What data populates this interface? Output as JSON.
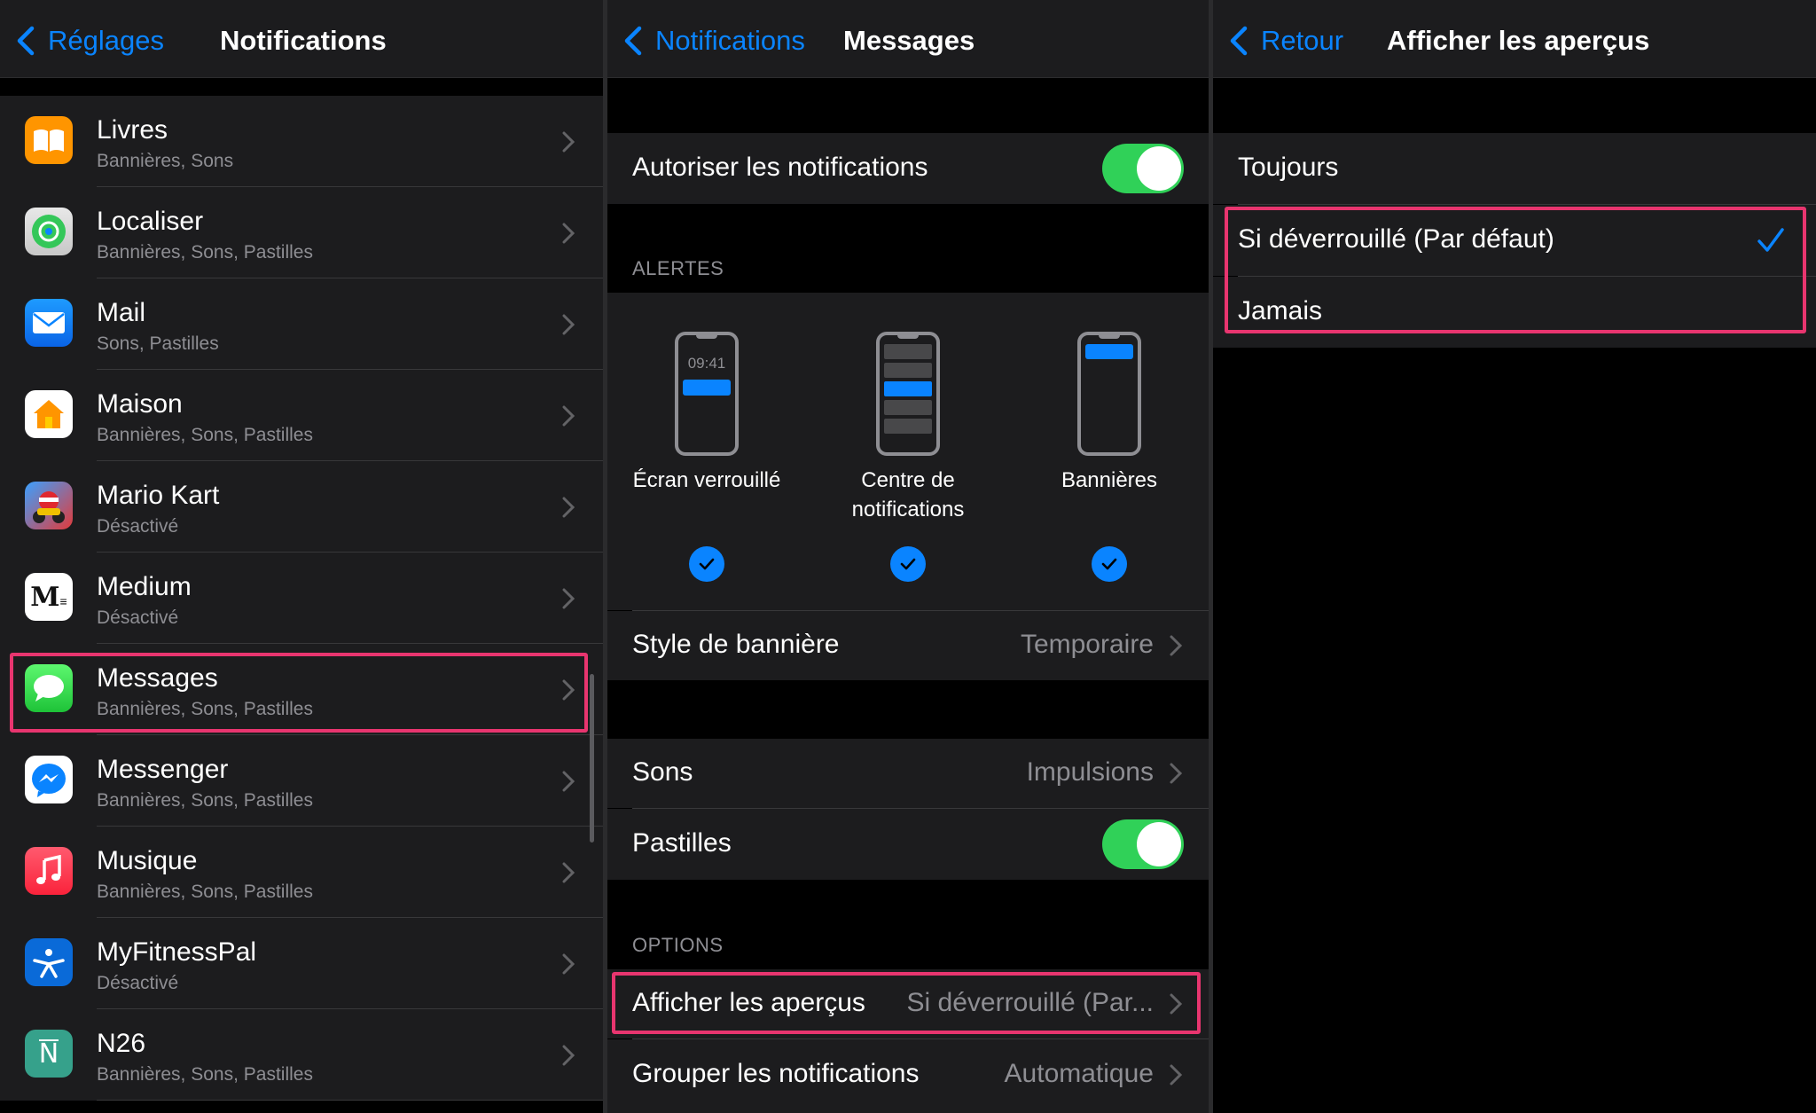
{
  "panel1": {
    "back_label": "Réglages",
    "title": "Notifications",
    "apps": [
      {
        "name": "Livres",
        "sub": "Bannières, Sons",
        "icon": "books-icon"
      },
      {
        "name": "Localiser",
        "sub": "Bannières, Sons, Pastilles",
        "icon": "find-my-icon"
      },
      {
        "name": "Mail",
        "sub": "Sons, Pastilles",
        "icon": "mail-icon"
      },
      {
        "name": "Maison",
        "sub": "Bannières, Sons, Pastilles",
        "icon": "home-icon"
      },
      {
        "name": "Mario Kart",
        "sub": "Désactivé",
        "icon": "mario-kart-icon"
      },
      {
        "name": "Medium",
        "sub": "Désactivé",
        "icon": "medium-icon"
      },
      {
        "name": "Messages",
        "sub": "Bannières, Sons, Pastilles",
        "icon": "messages-icon"
      },
      {
        "name": "Messenger",
        "sub": "Bannières, Sons, Pastilles",
        "icon": "messenger-icon"
      },
      {
        "name": "Musique",
        "sub": "Bannières, Sons, Pastilles",
        "icon": "music-icon"
      },
      {
        "name": "MyFitnessPal",
        "sub": "Désactivé",
        "icon": "myfitnesspal-icon"
      },
      {
        "name": "N26",
        "sub": "Bannières, Sons, Pastilles",
        "icon": "n26-icon"
      }
    ],
    "highlighted_app": "Messages"
  },
  "panel2": {
    "back_label": "Notifications",
    "title": "Messages",
    "allow_label": "Autoriser les notifications",
    "allow_on": true,
    "alerts_header": "ALERTES",
    "lock_time": "09:41",
    "alert_styles": [
      {
        "label": "Écran verrouillé",
        "checked": true
      },
      {
        "label": "Centre de notifications",
        "checked": true
      },
      {
        "label": "Bannières",
        "checked": true
      }
    ],
    "banner_style_label": "Style de bannière",
    "banner_style_value": "Temporaire",
    "sounds_label": "Sons",
    "sounds_value": "Impulsions",
    "badges_label": "Pastilles",
    "badges_on": true,
    "options_header": "OPTIONS",
    "previews_label": "Afficher les aperçus",
    "previews_value": "Si déverrouillé (Par...",
    "grouping_label": "Grouper les notifications",
    "grouping_value": "Automatique"
  },
  "panel3": {
    "back_label": "Retour",
    "title": "Afficher les aperçus",
    "options": [
      {
        "label": "Toujours",
        "selected": false
      },
      {
        "label": "Si déverrouillé (Par défaut)",
        "selected": true
      },
      {
        "label": "Jamais",
        "selected": false
      }
    ]
  },
  "colors": {
    "accent": "#0a84ff",
    "toggle_on": "#30d158",
    "highlight": "#e8356f",
    "cell_bg": "#1c1c1e",
    "secondary_text": "#8e8e93"
  }
}
